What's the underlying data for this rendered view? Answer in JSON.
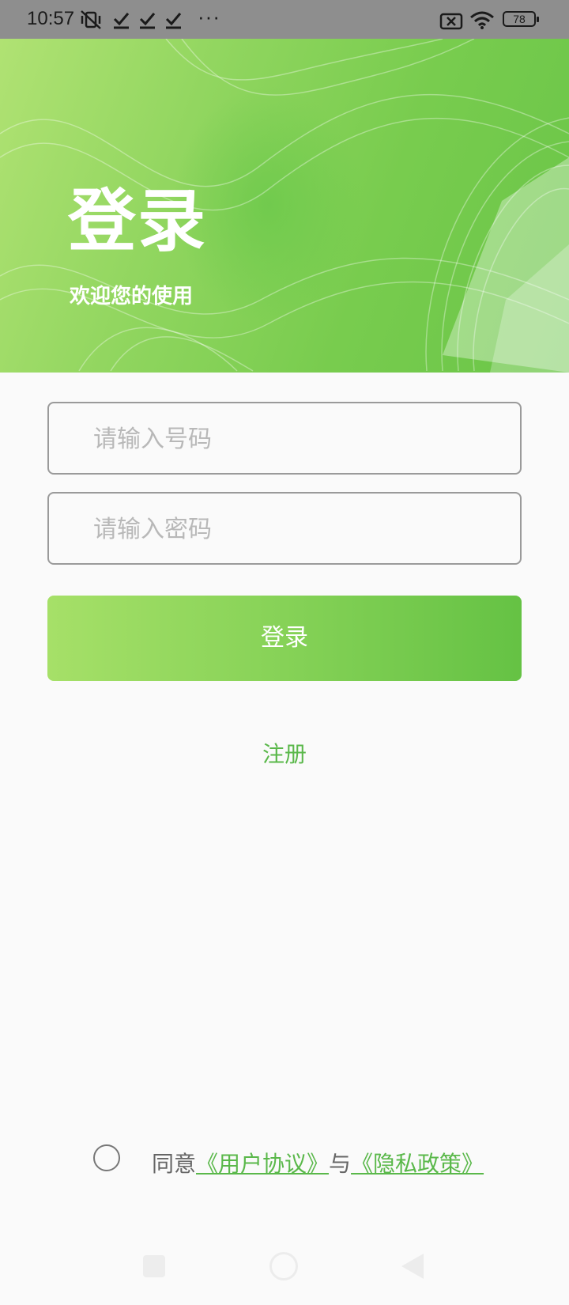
{
  "status_bar": {
    "time": "10:57",
    "overflow": "···",
    "battery": "78",
    "icons": [
      "vibrate-off-icon",
      "check-icon",
      "check-icon",
      "check-icon",
      "sim-off-icon",
      "wifi-icon",
      "battery-icon"
    ]
  },
  "header": {
    "title": "登录",
    "subtitle": "欢迎您的使用"
  },
  "form": {
    "phone_placeholder": "请输入号码",
    "password_placeholder": "请输入密码",
    "login_label": "登录",
    "register_label": "注册"
  },
  "agreement": {
    "prefix": "同意",
    "user_agreement": "《用户协议》",
    "connector": "与",
    "privacy_policy": "《隐私政策》",
    "checked": false
  },
  "colors": {
    "accent": "#5ab84a",
    "gradient_start": "#a6e068",
    "gradient_end": "#65c244"
  }
}
